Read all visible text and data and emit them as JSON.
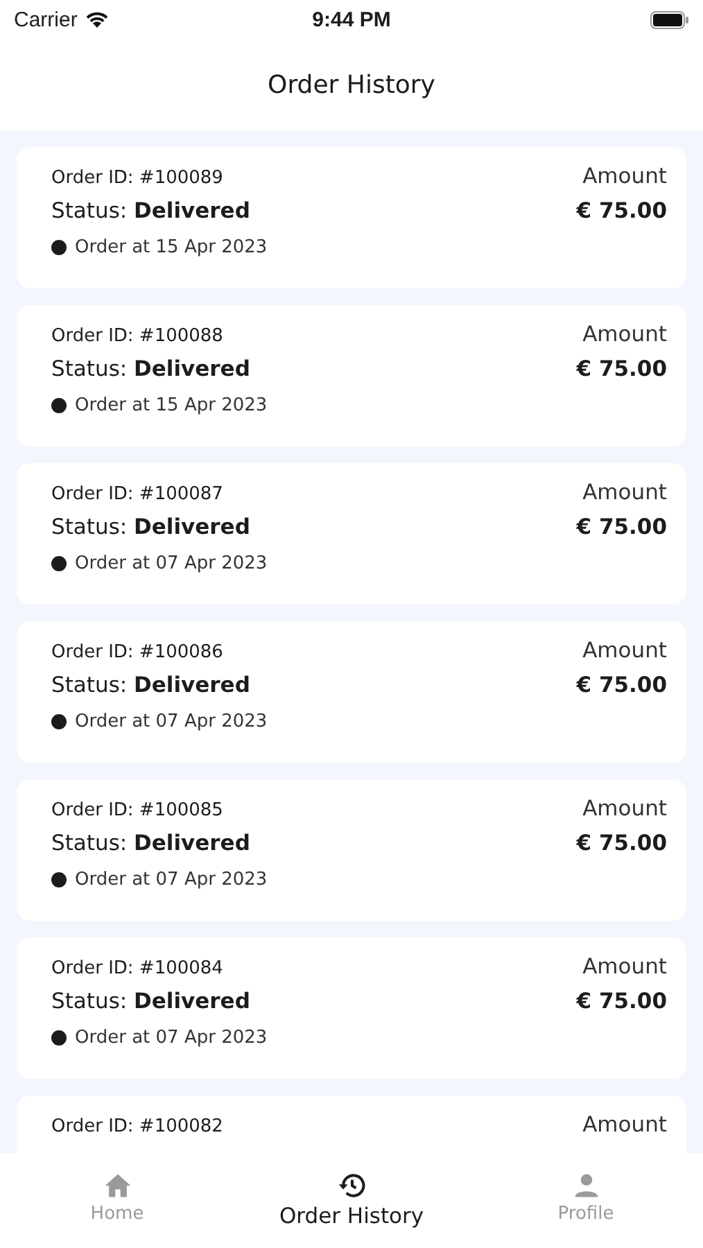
{
  "status_bar": {
    "carrier": "Carrier",
    "time": "9:44 PM"
  },
  "header": {
    "title": "Order History"
  },
  "orders": [
    {
      "order_id": "Order ID: #100089",
      "status": "Status: **Delivered**",
      "date": "Order at 15 Apr 2023",
      "amount_label": "Amount",
      "amount": "€ 75.00"
    },
    {
      "order_id": "Order ID: #100088",
      "status": "Status: **Delivered**",
      "date": "Order at 15 Apr 2023",
      "amount_label": "Amount",
      "amount": "€ 75.00"
    },
    {
      "order_id": "Order ID: #100087",
      "status": "Status: **Delivered**",
      "date": "Order at 07 Apr 2023",
      "amount_label": "Amount",
      "amount": "€ 75.00"
    },
    {
      "order_id": "Order ID: #100086",
      "status": "Status: **Delivered**",
      "date": "Order at 07 Apr 2023",
      "amount_label": "Amount",
      "amount": "€ 75.00"
    },
    {
      "order_id": "Order ID: #100085",
      "status": "Status: **Delivered**",
      "date": "Order at 07 Apr 2023",
      "amount_label": "Amount",
      "amount": "€ 75.00"
    },
    {
      "order_id": "Order ID: #100084",
      "status": "Status: **Delivered**",
      "date": "Order at 07 Apr 2023",
      "amount_label": "Amount",
      "amount": "€ 75.00"
    },
    {
      "order_id": "Order ID: #100082",
      "amount_label": "Amount"
    }
  ],
  "tab_bar": [
    {
      "kind": "home",
      "label": "Home",
      "selected": false
    },
    {
      "kind": "history",
      "label": "Order History",
      "selected": true
    },
    {
      "kind": "profile",
      "label": "Profile",
      "selected": false
    }
  ]
}
